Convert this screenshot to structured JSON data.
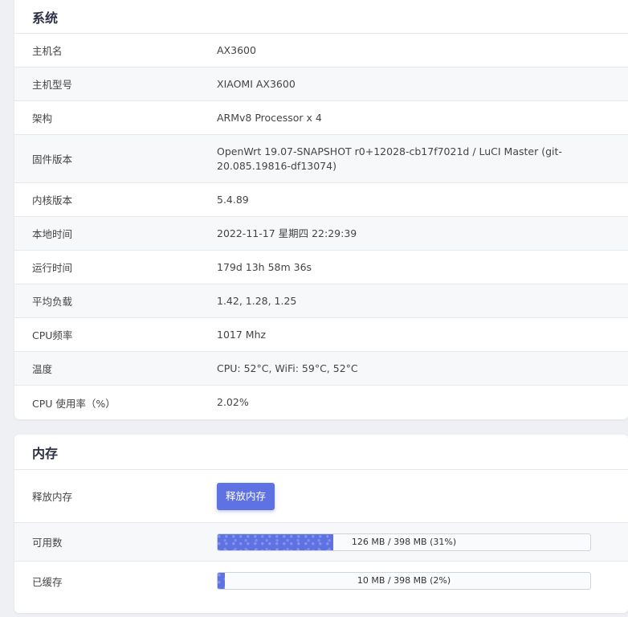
{
  "system": {
    "title": "系统",
    "rows": [
      {
        "label": "主机名",
        "value": "AX3600"
      },
      {
        "label": "主机型号",
        "value": "XIAOMI AX3600"
      },
      {
        "label": "架构",
        "value": "ARMv8 Processor x 4"
      },
      {
        "label": "固件版本",
        "value": "OpenWrt 19.07-SNAPSHOT r0+12028-cb17f7021d / LuCI Master (git-20.085.19816-df13074)"
      },
      {
        "label": "内核版本",
        "value": "5.4.89"
      },
      {
        "label": "本地时间",
        "value": "2022-11-17 星期四 22:29:39"
      },
      {
        "label": "运行时间",
        "value": "179d 13h 58m 36s"
      },
      {
        "label": "平均负载",
        "value": "1.42, 1.28, 1.25"
      },
      {
        "label": "CPU频率",
        "value": "1017 Mhz"
      },
      {
        "label": "温度",
        "value": "CPU: 52°C, WiFi: 59°C, 52°C"
      },
      {
        "label": "CPU 使用率（%）",
        "value": "2.02%"
      }
    ]
  },
  "memory": {
    "title": "内存",
    "release": {
      "label": "释放内存",
      "button_label": "释放内存"
    },
    "available": {
      "label": "可用数",
      "text": "126 MB / 398 MB (31%)",
      "percent": 31
    },
    "cached": {
      "label": "已缓存",
      "text": "10 MB / 398 MB (2%)",
      "percent": 2
    },
    "accent_color": "#5e72e4"
  }
}
